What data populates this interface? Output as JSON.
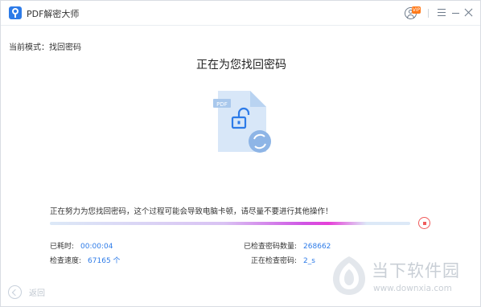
{
  "app": {
    "title": "PDF解密大师",
    "vip_badge": "VIP"
  },
  "mode": {
    "label": "当前模式：找回密码"
  },
  "main": {
    "title": "正在为您找回密码",
    "illustration_badge": "PDF",
    "status_message": "正在努力为您找回密码，这个过程可能会导致电脑卡顿，请尽量不要进行其他操作！",
    "progress_fraction": 0.88
  },
  "stats": {
    "elapsed_label": "已耗时:",
    "elapsed_value": "00:00:04",
    "speed_label": "检查速度:",
    "speed_value": "67165 个",
    "checked_label": "已检查密码数量:",
    "checked_value": "268662",
    "current_label": "正在检查密码:",
    "current_value": "2_s"
  },
  "footer": {
    "back_label": "返回"
  },
  "watermark": {
    "text": "当下软件园",
    "url": "www.downxia.com"
  },
  "colors": {
    "accent": "#2d7be8",
    "stop": "#f05b5b",
    "progress_highlight": "#e63fd8"
  },
  "icons": {
    "app_logo": "key-icon",
    "user": "user-icon",
    "menu": "menu-icon",
    "minimize": "minimize-icon",
    "close": "close-icon",
    "stop": "stop-icon",
    "back": "back-arrow-icon"
  }
}
